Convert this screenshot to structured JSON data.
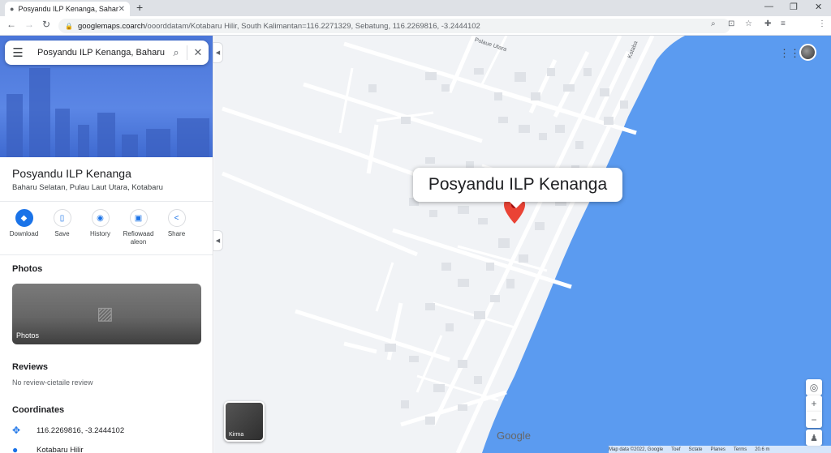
{
  "browser": {
    "tab_title": "Posyandu ILP Kenanga, Saharu",
    "url_domain": "googlemaps.coarch",
    "url_rest": "/ooorddatam/Kotabaru Hilir, South Kalimantan=116.2271329, Sebatung, 116.2269816, -3.2444102"
  },
  "search": {
    "query": "Posyandu ILP Kenanga, Baharu"
  },
  "place": {
    "name": "Posyandu ILP Kenanga",
    "address": "Baharu Selatan, Pulau Laut Utara, Kotabaru"
  },
  "actions": [
    {
      "label": "Download",
      "icon": "directions-icon"
    },
    {
      "label": "Save",
      "icon": "bookmark-icon"
    },
    {
      "label": "History",
      "icon": "history-icon"
    },
    {
      "label": "Refiowaad aleon",
      "icon": "phone-icon"
    },
    {
      "label": "Share",
      "icon": "share-icon"
    }
  ],
  "photos": {
    "title": "Photos",
    "card_label": "Photos"
  },
  "reviews": {
    "title": "Reviews",
    "text": "No review-cietaile review"
  },
  "coordinates": {
    "title": "Coordinates",
    "value": "116.2269816, -3.2444102",
    "next_item": "Kotabaru Hilir"
  },
  "map": {
    "callout": "Posyandu ILP Kenanga",
    "street_label_1": "Polaue Utara",
    "street_label_2": "Kotaba",
    "layers_label": "Kirma",
    "logo": "Google",
    "footer": [
      "Map data ©2022, Google",
      "Toef",
      "Sctate",
      "Planes",
      "Terms",
      "20.6 m"
    ],
    "colors": {
      "water": "#5b9bf0",
      "land": "#f1f3f6",
      "road": "#ffffff",
      "pin": "#ea4335"
    }
  }
}
